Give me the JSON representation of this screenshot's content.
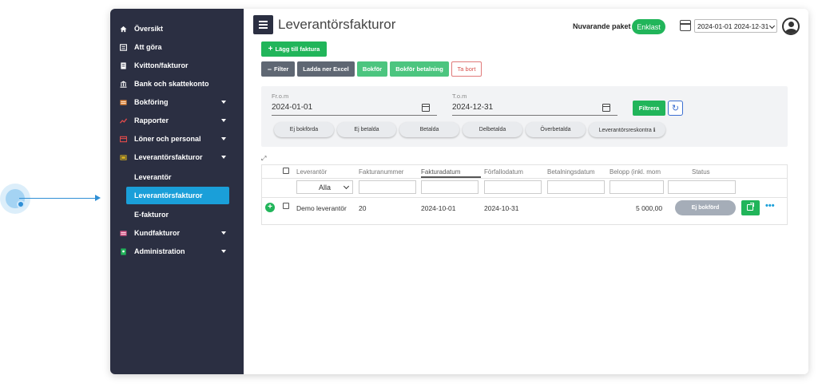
{
  "sidebar": {
    "items": [
      {
        "label": "Översikt",
        "icon": "home-icon",
        "has_caret": false
      },
      {
        "label": "Att göra",
        "icon": "list-icon",
        "has_caret": false
      },
      {
        "label": "Kvitton/fakturor",
        "icon": "receipt-icon",
        "has_caret": false
      },
      {
        "label": "Bank och skattekonto",
        "icon": "bank-icon",
        "has_caret": false
      },
      {
        "label": "Bokföring",
        "icon": "ledger-icon",
        "has_caret": true
      },
      {
        "label": "Rapporter",
        "icon": "chart-icon",
        "has_caret": true
      },
      {
        "label": "Löner och personal",
        "icon": "id-card-icon",
        "has_caret": true
      },
      {
        "label": "Leverantörsfakturor",
        "icon": "invoice-icon",
        "has_caret": true
      },
      {
        "label": "Kundfakturor",
        "icon": "invoice-icon",
        "has_caret": true
      },
      {
        "label": "Administration",
        "icon": "admin-icon",
        "has_caret": true
      }
    ],
    "subitems": [
      {
        "label": "Leverantör",
        "active": false
      },
      {
        "label": "Leverantörsfakturor",
        "active": true
      },
      {
        "label": "E-fakturor",
        "active": false
      }
    ]
  },
  "header": {
    "title": "Leverantörsfakturor",
    "package_label": "Nuvarande paket",
    "package_name": "Enklast",
    "period": "2024-01-01 2024-12-31"
  },
  "toolbar": {
    "add_label": "Lägg till faktura",
    "filter_label": "Filter",
    "excel_label": "Ladda ner Excel",
    "book_label": "Bokför",
    "book_payment_label": "Bokför betalning",
    "delete_label": "Ta bort"
  },
  "filters": {
    "from_label": "Fr.o.m",
    "from_value": "2024-01-01",
    "to_label": "T.o.m",
    "to_value": "2024-12-31",
    "apply_label": "Filtrera",
    "pills": [
      "Ej bokförda",
      "Ej betalda",
      "Betalda",
      "Delbetalda",
      "Överbetalda",
      "Leverantörsreskontra ℹ"
    ]
  },
  "table": {
    "columns": [
      "Leverantör",
      "Fakturanummer",
      "Fakturadatum",
      "Förfallodatum",
      "Betalningsdatum",
      "Belopp (inkl. mom",
      "Status"
    ],
    "supplier_filter": "Alla",
    "rows": [
      {
        "supplier": "Demo leverantör",
        "invoice_number": "20",
        "invoice_date": "2024-10-01",
        "due_date": "2024-10-31",
        "payment_date": "",
        "amount": "5 000,00",
        "status": "Ej bokförd"
      }
    ]
  },
  "colors": {
    "sidebar_bg": "#2b2f42",
    "accent_blue": "#1a9fd9",
    "green": "#21b55a",
    "grey_button": "#5f6773",
    "status_grey": "#a5adb8"
  }
}
